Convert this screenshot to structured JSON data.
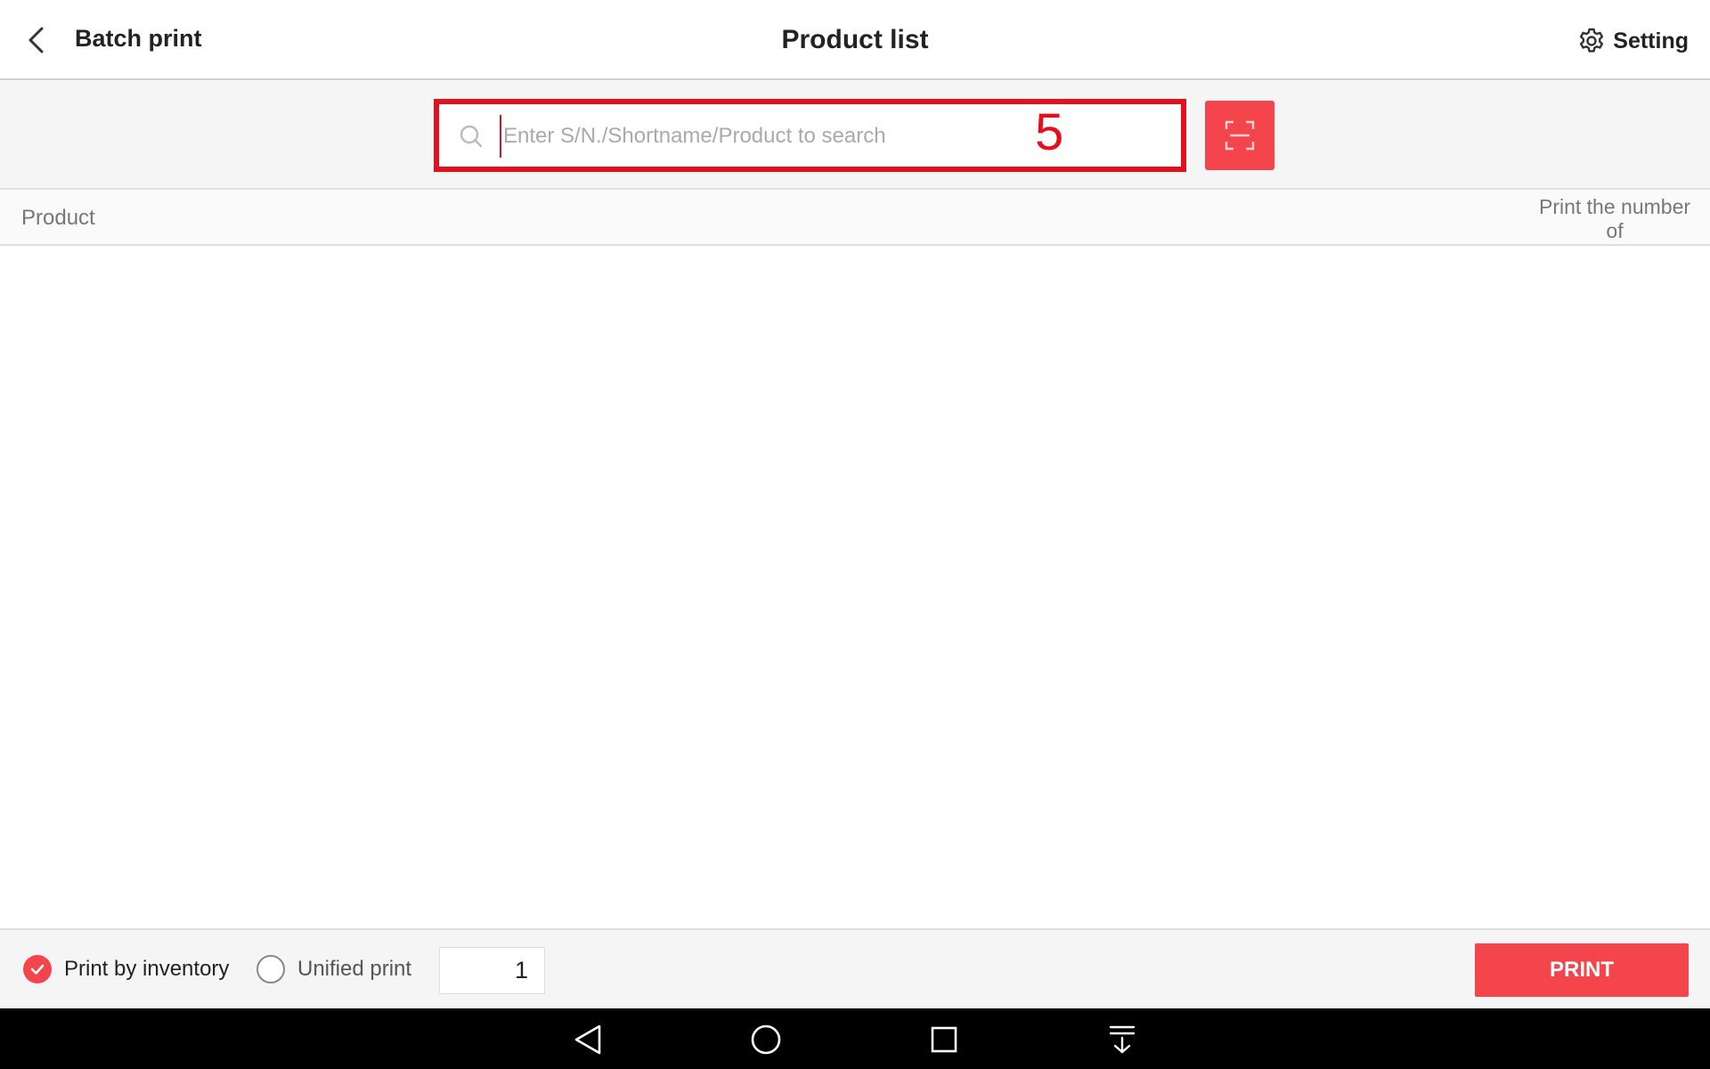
{
  "header": {
    "back_label": "Batch print",
    "title": "Product list",
    "setting_label": "Setting"
  },
  "search": {
    "placeholder": "Enter S/N./Shortname/Product to search",
    "value": "",
    "step_badge": "5",
    "highlight_color": "#e3101e"
  },
  "table": {
    "columns": [
      "Product",
      "Print the number of"
    ],
    "rows": []
  },
  "footer": {
    "option_inventory": "Print by inventory",
    "option_unified": "Unified print",
    "selected_option": "Print by inventory",
    "quantity": "1",
    "print_label": "PRINT"
  },
  "navbar": {
    "icons": [
      "back-triangle-icon",
      "home-circle-icon",
      "recents-square-icon",
      "notification-pull-icon"
    ]
  },
  "colors": {
    "accent": "#f4454d",
    "text": "#222222",
    "muted": "#777777"
  }
}
